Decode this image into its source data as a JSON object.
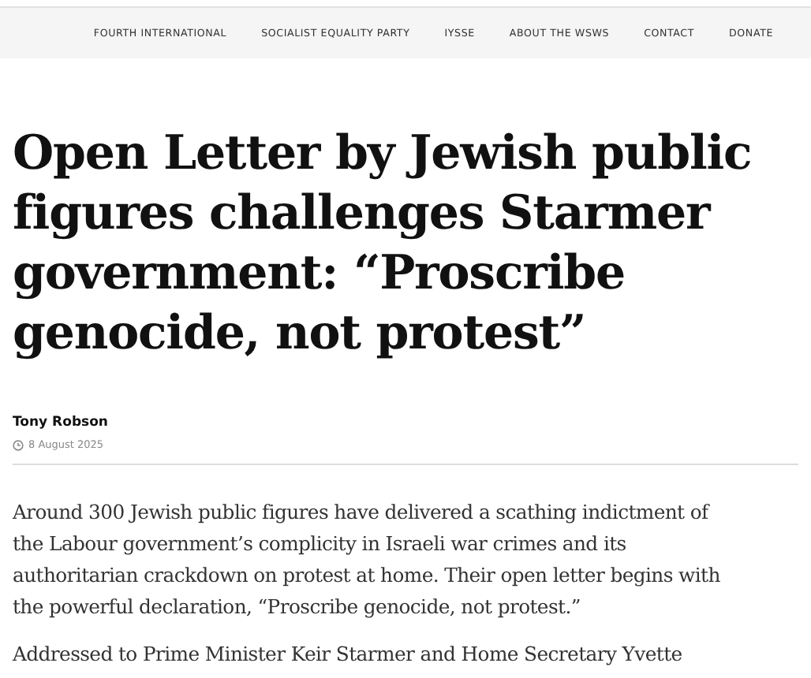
{
  "nav": {
    "items": [
      "FOURTH INTERNATIONAL",
      "SOCIALIST EQUALITY PARTY",
      "IYSSE",
      "ABOUT THE WSWS",
      "CONTACT",
      "DONATE"
    ]
  },
  "article": {
    "headline": "Open Letter by Jewish public figures challenges Starmer government: “Proscribe genocide, not protest”",
    "author": "Tony Robson",
    "date": "8 August 2025",
    "paragraphs": [
      "Around 300 Jewish public figures have delivered a scathing indictment of the Labour government’s complicity in Israeli war crimes and its authoritarian crackdown on protest at home. Their open letter begins with the powerful declaration, “Proscribe genocide, not protest.”",
      "Addressed to Prime Minister Keir Starmer and Home Secretary Yvette"
    ]
  }
}
